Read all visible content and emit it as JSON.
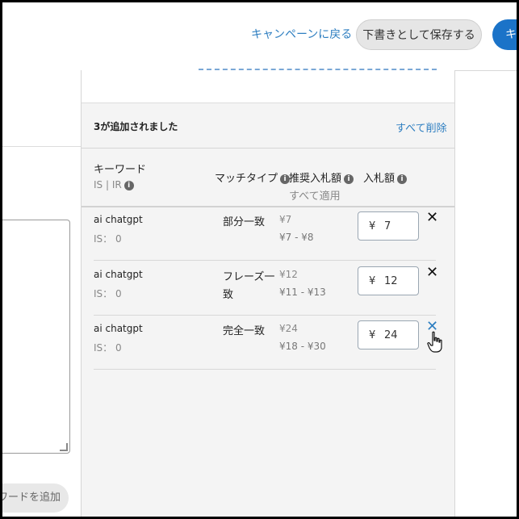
{
  "header": {
    "back_link": "キャンペーンに戻る",
    "save_draft": "下書きとして保存する",
    "primary_button": "キ"
  },
  "left_panel": {
    "add_keyword_button": "ワードを追加"
  },
  "right_panel": {
    "added_title": "3が追加されました",
    "delete_all": "すべて削除",
    "columns": {
      "keyword": "キーワード",
      "is_ir": "IS | IR",
      "match_type": "マッチタイプ",
      "recommended_bid": "推奨入札額",
      "apply_all": "すべて適用",
      "bid": "入札額"
    },
    "rows": [
      {
        "keyword": "ai chatgpt",
        "is": "IS： 0",
        "match_type": "部分一致",
        "rec_bid": "¥7",
        "rec_range": "¥7 - ¥8",
        "currency": "¥",
        "bid": "7"
      },
      {
        "keyword": "ai chatgpt",
        "is": "IS： 0",
        "match_type": "フレーズ一致",
        "rec_bid": "¥12",
        "rec_range": "¥11 - ¥13",
        "currency": "¥",
        "bid": "12"
      },
      {
        "keyword": "ai chatgpt",
        "is": "IS： 0",
        "match_type": "完全一致",
        "rec_bid": "¥24",
        "rec_range": "¥18 - ¥30",
        "currency": "¥",
        "bid": "24"
      }
    ],
    "remove_icon": "close-icon",
    "hover_color": "#2f7fc1"
  },
  "colors": {
    "accent": "#2f7fc1",
    "primary_button_bg": "#1b73c8",
    "panel_bg": "#f4f4f4"
  }
}
